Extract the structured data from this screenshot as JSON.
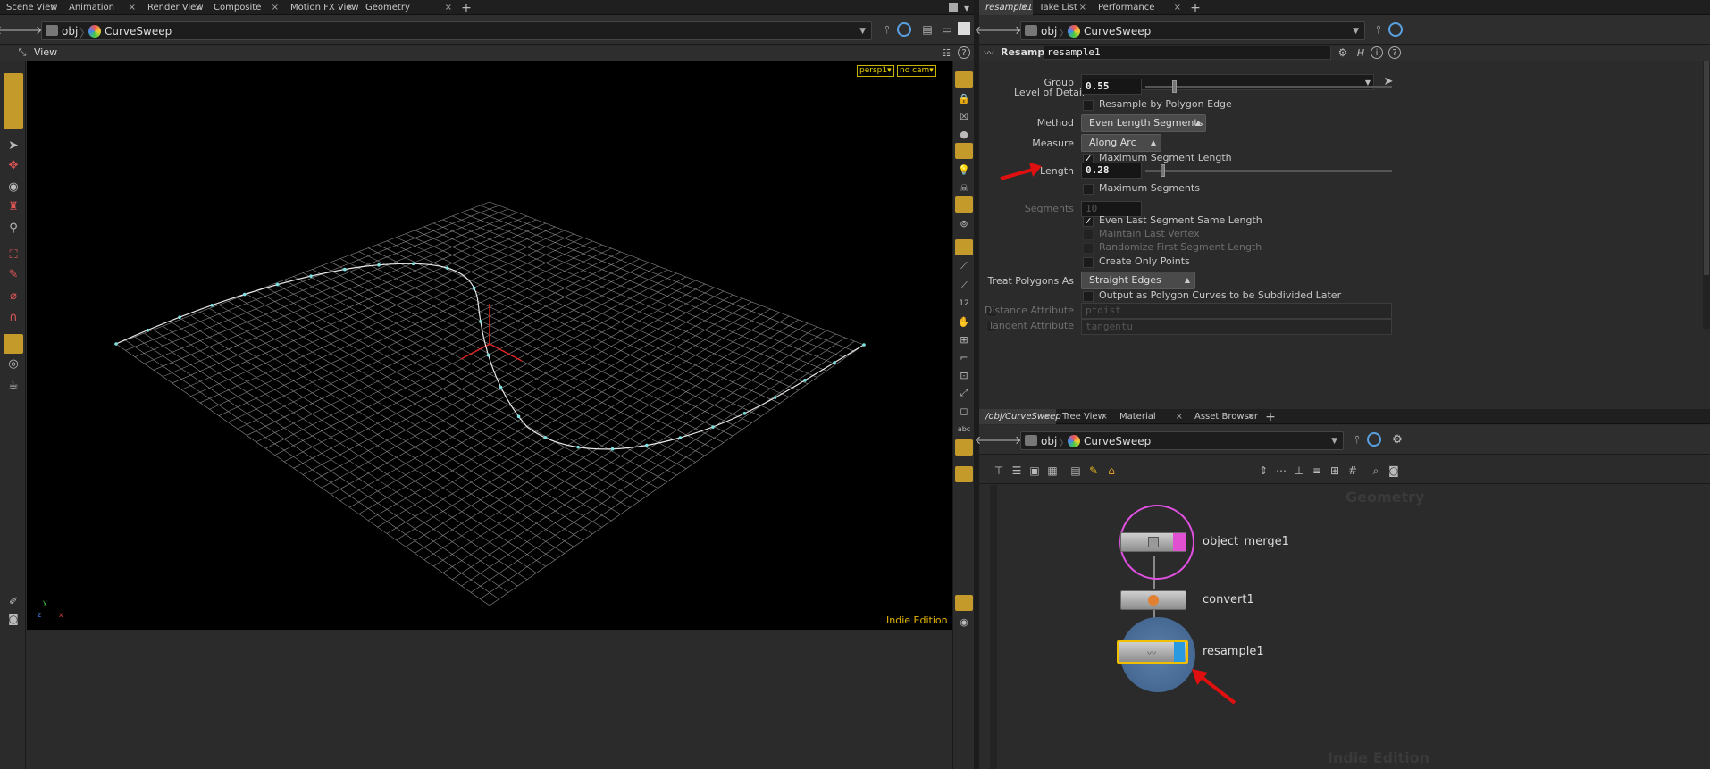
{
  "left_tabs": [
    {
      "label": "Scene View"
    },
    {
      "label": "Animation Editor"
    },
    {
      "label": "Render View"
    },
    {
      "label": "Composite View"
    },
    {
      "label": "Motion FX View"
    },
    {
      "label": "Geometry Spreadsheet"
    }
  ],
  "right_tabs": [
    {
      "label": "resample1"
    },
    {
      "label": "Take List"
    },
    {
      "label": "Performance Monitor"
    }
  ],
  "network_tabs": [
    {
      "label": "/obj/CurveSweep"
    },
    {
      "label": "Tree View"
    },
    {
      "label": "Material Palette"
    },
    {
      "label": "Asset Browser"
    }
  ],
  "path": {
    "obj": "obj",
    "node": "CurveSweep"
  },
  "viewport": {
    "title": "View",
    "camera_menu": "persp1▾",
    "nocam_menu": "no cam▾",
    "edition": "Indie Edition",
    "axis_y": "y",
    "axis_x": "x",
    "axis_z": "z"
  },
  "params": {
    "node_type": "Resample",
    "node_name": "resample1",
    "group_label": "Group",
    "lod_label": "Level of Detail",
    "lod_value": "0.55",
    "lod_fraction": 0.11,
    "resample_by_edge": "Resample by Polygon Edge",
    "method_label": "Method",
    "method_value": "Even Length Segments",
    "measure_label": "Measure",
    "measure_value": "Along Arc",
    "max_seg_len": "Maximum Segment Length",
    "length_label": "Length",
    "length_value": "0.28",
    "length_fraction": 0.06,
    "max_segments": "Maximum Segments",
    "segments_label": "Segments",
    "segments_value": "10",
    "even_last": "Even Last Segment Same Length",
    "maintain_last": "Maintain Last Vertex",
    "randomize_first": "Randomize First Segment Length",
    "create_points": "Create Only Points",
    "treat_label": "Treat Polygons As",
    "treat_value": "Straight Edges",
    "output_subdiv": "Output as Polygon Curves to be Subdivided Later",
    "dist_attr_label": "Distance Attribute",
    "dist_attr_value": "ptdist",
    "tan_attr_label": "Tangent Attribute",
    "tan_attr_value": "tangentu"
  },
  "network": {
    "context": "Geometry",
    "edition": "Indie Edition",
    "nodes": [
      {
        "name": "object_merge1"
      },
      {
        "name": "convert1"
      },
      {
        "name": "resample1"
      }
    ]
  },
  "colors": {
    "accent": "#c49a2a",
    "arrow": "#e01010",
    "curve": "#7fe0e0",
    "selected_node": "#f0c000"
  }
}
